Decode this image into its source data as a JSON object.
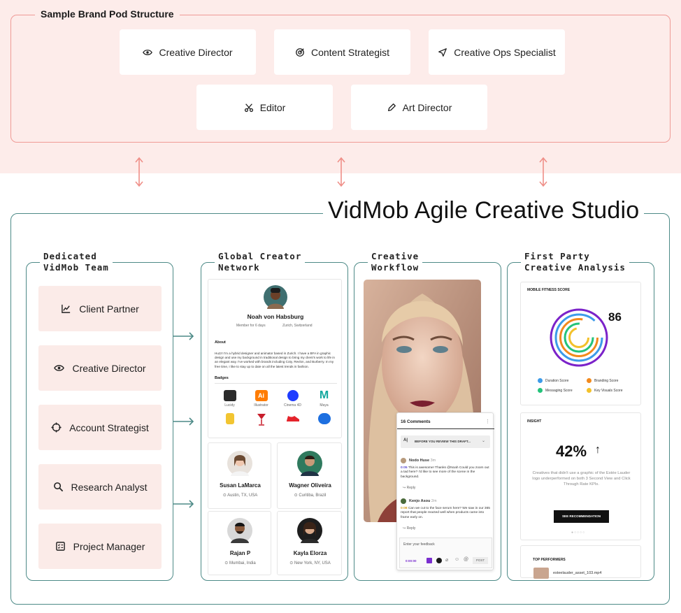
{
  "pod": {
    "title": "Sample Brand Pod Structure",
    "roles": [
      {
        "label": "Creative Director",
        "icon": "eye-icon"
      },
      {
        "label": "Content Strategist",
        "icon": "target-icon"
      },
      {
        "label": "Creative Ops Specialist",
        "icon": "navigation-arrow-icon"
      },
      {
        "label": "Editor",
        "icon": "scissors-icon"
      },
      {
        "label": "Art Director",
        "icon": "pen-icon"
      }
    ]
  },
  "studio": {
    "title": "VidMob Agile Creative Studio",
    "columns": [
      {
        "label_line1": "Dedicated",
        "label_line2": "VidMob Team"
      },
      {
        "label_line1": "Global Creator",
        "label_line2": "Network"
      },
      {
        "label_line1": "Creative",
        "label_line2": "Workflow"
      },
      {
        "label_line1": "First Party",
        "label_line2": "Creative Analysis"
      }
    ]
  },
  "team": [
    {
      "label": "Client Partner",
      "icon": "chart-line-icon"
    },
    {
      "label": "Creative Director",
      "icon": "eye-icon"
    },
    {
      "label": "Account Strategist",
      "icon": "crosshair-icon"
    },
    {
      "label": "Research Analyst",
      "icon": "search-icon"
    },
    {
      "label": "Project Manager",
      "icon": "checklist-icon"
    }
  ],
  "creator": {
    "name": "Noah von Habsburg",
    "meta1": "Member for 6 days",
    "meta2": "Zurich, Switzerland",
    "about_heading": "About",
    "about": "Huzz! I'm a hybrid designer and animator based in Zurich. I have a BFA in graphic design and use my background in traditional design to bring my client's work to life in an elegant way. I've worked with brands including Coty, Revlon, and Burberry. In my free time, I like to stay up to date on all the latest trends in fashion.",
    "badges_heading": "Badges",
    "badges": [
      {
        "label": "Lucidy",
        "icon": "lucidy-badge-icon",
        "color": "#2b2b2b"
      },
      {
        "label": "Illustrator",
        "icon": "illustrator-badge-icon",
        "color": "#ff7c00"
      },
      {
        "label": "Cinema 4D",
        "icon": "cinema4d-badge-icon",
        "color": "#1e3cff"
      },
      {
        "label": "Maya",
        "icon": "maya-badge-icon",
        "color": "#13a89e"
      },
      {
        "label": "",
        "icon": "bottle-badge-icon",
        "color": "#f2c531"
      },
      {
        "label": "",
        "icon": "glass-badge-icon",
        "color": "#c81e2c"
      },
      {
        "label": "",
        "icon": "shoe-badge-icon",
        "color": "#e4232b"
      },
      {
        "label": "",
        "icon": "gaming-badge-icon",
        "color": "#1d6fe0"
      }
    ]
  },
  "creators": [
    {
      "name": "Susan LaMarca",
      "location": "Austin, TX, USA"
    },
    {
      "name": "Wagner Oliveira",
      "location": "Curitiba, Brazil"
    },
    {
      "name": "Rajan P",
      "location": "Mumbai, India"
    },
    {
      "name": "Kayla Elorza",
      "location": "New York, NY, USA"
    }
  ],
  "workflow": {
    "comments_title": "16 Comments",
    "brief": "BEFORE YOU REVIEW THIS DRAFT...",
    "comments": [
      {
        "author": "Nodo Huse",
        "time": "3m",
        "stamp": "0:05",
        "text": "This is awesome! Thanks @Noah Could you zoom out a tad here? I'd like to see more of the scene in the background.",
        "reply": "Reply"
      },
      {
        "author": "Kenjo Asou",
        "time": "2m",
        "stamp": "0:08",
        "text": "Can we cut to the face serum here? We saw in our 365 report that people reacted well when products came into frame early on.",
        "reply": "Reply"
      }
    ],
    "feedback_placeholder": "Enter your feedback",
    "feedback_stamp": "0:00:00",
    "post_label": "POST"
  },
  "analysis": {
    "fitness_title": "MOBILE FITNESS SCORE",
    "score": "86",
    "legend": [
      {
        "label": "Duration Score",
        "color": "#3d9be9"
      },
      {
        "label": "Branding Score",
        "color": "#f28a1d"
      },
      {
        "label": "Messaging Score",
        "color": "#24c37a"
      },
      {
        "label": "Key Visuals Score",
        "color": "#f3c12b"
      }
    ],
    "ring_color": "#7b22c9",
    "insight_title": "INSIGHT",
    "insight_value": "42%",
    "insight_text": "Creatives that didn't use a graphic of the Estée Lauder logo underperformed on both 3 Second View and Click Through Rate KPIs.",
    "insight_button": "SEE RECOMMENDATION",
    "top_title": "TOP PERFORMERS",
    "top_asset": "esteelauder_asset_103.mp4"
  }
}
